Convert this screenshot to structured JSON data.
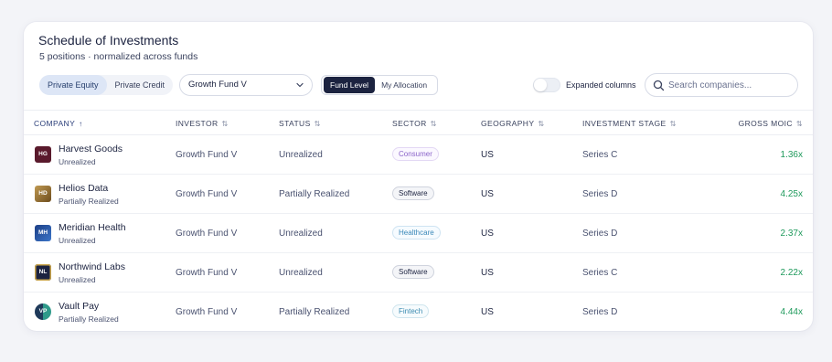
{
  "header": {
    "title": "Schedule of Investments",
    "subtitle": "5 positions · normalized across funds"
  },
  "filters": {
    "asset_class_tabs": [
      {
        "label": "Private Equity",
        "active": true
      },
      {
        "label": "Private Credit",
        "active": false
      }
    ],
    "fund_select": {
      "value": "Growth Fund V"
    },
    "view_tabs": [
      {
        "label": "Fund Level",
        "active": true
      },
      {
        "label": "My Allocation",
        "active": false
      }
    ],
    "expanded_columns": {
      "label": "Expanded columns",
      "on": false
    },
    "search": {
      "placeholder": "Search companies...",
      "value": ""
    }
  },
  "table": {
    "columns": [
      {
        "label": "COMPANY",
        "sort_icon": "↑",
        "sorted": true
      },
      {
        "label": "INVESTOR",
        "sort_icon": "⇅"
      },
      {
        "label": "STATUS",
        "sort_icon": "⇅"
      },
      {
        "label": "SECTOR",
        "sort_icon": "⇅"
      },
      {
        "label": "GEOGRAPHY",
        "sort_icon": "⇅"
      },
      {
        "label": "INVESTMENT STAGE",
        "sort_icon": "⇅"
      },
      {
        "label": "GROSS MOIC",
        "sort_icon": "⇅"
      }
    ],
    "rows": [
      {
        "initials": "HG",
        "logo_color": "#5a1a2c",
        "logo_shape": "square",
        "company": "Harvest Goods",
        "company_status": "Unrealized",
        "investor": "Growth Fund V",
        "status": "Unrealized",
        "sector": "Consumer",
        "sector_style": "consumer",
        "geography": "US",
        "stage": "Series C",
        "moic": "1.36x"
      },
      {
        "initials": "HD",
        "logo_color": "#a6803f",
        "logo_shape": "square",
        "company": "Helios Data",
        "company_status": "Partially Realized",
        "investor": "Growth Fund V",
        "status": "Partially Realized",
        "sector": "Software",
        "sector_style": "software",
        "geography": "US",
        "stage": "Series D",
        "moic": "4.25x"
      },
      {
        "initials": "MH",
        "logo_color": "#2c5aa8",
        "logo_shape": "square",
        "company": "Meridian Health",
        "company_status": "Unrealized",
        "investor": "Growth Fund V",
        "status": "Unrealized",
        "sector": "Healthcare",
        "sector_style": "healthcare",
        "geography": "US",
        "stage": "Series D",
        "moic": "2.37x"
      },
      {
        "initials": "NL",
        "logo_color": "#1c2340",
        "logo_shape": "square",
        "company": "Northwind Labs",
        "company_status": "Unrealized",
        "investor": "Growth Fund V",
        "status": "Unrealized",
        "sector": "Software",
        "sector_style": "software",
        "geography": "US",
        "stage": "Series C",
        "moic": "2.22x"
      },
      {
        "initials": "VP",
        "logo_color": "#1f6e78",
        "logo_shape": "circle",
        "company": "Vault Pay",
        "company_status": "Partially Realized",
        "investor": "Growth Fund V",
        "status": "Partially Realized",
        "sector": "Fintech",
        "sector_style": "fintech",
        "geography": "US",
        "stage": "Series D",
        "moic": "4.44x"
      }
    ]
  },
  "colors": {
    "accent_dark": "#1c2340",
    "active_tab_bg": "#dde6f6",
    "moic_positive": "#1f9a5c"
  }
}
